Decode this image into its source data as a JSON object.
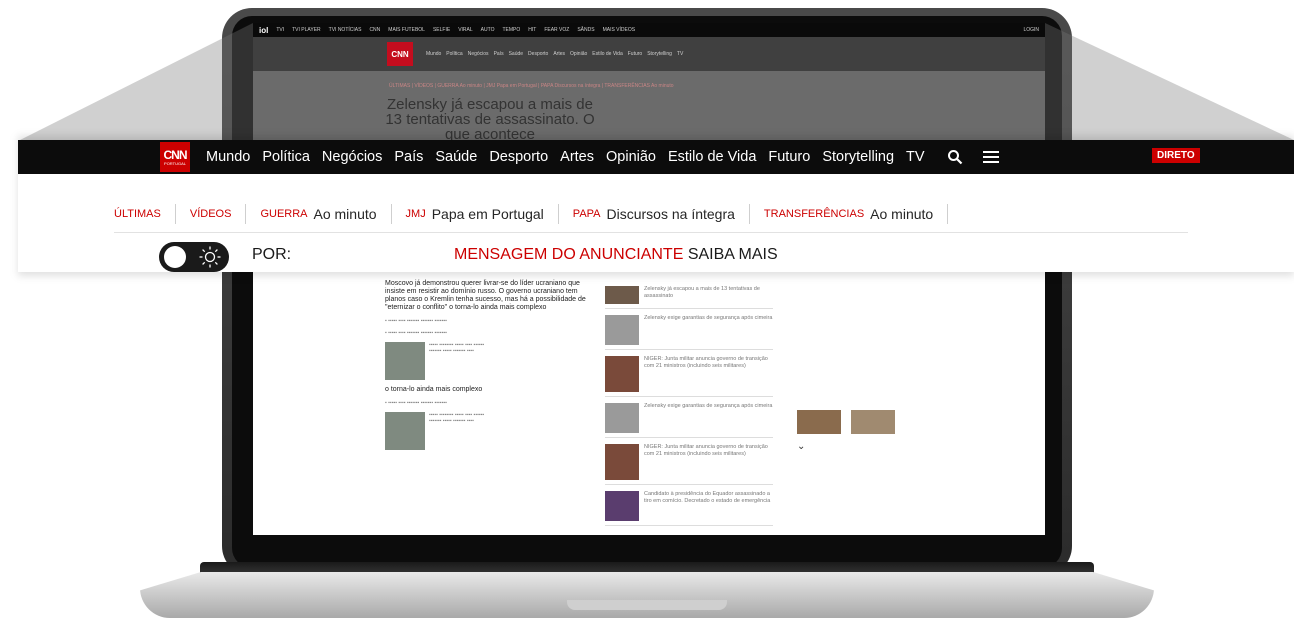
{
  "background_site": {
    "topbar": {
      "brand": "iol",
      "items": [
        "TVI",
        "TVI PLAYER",
        "TVI NOTÍCIAS",
        "CNN",
        "MAIS FUTEBOL",
        "SELFIE",
        "VIRAL",
        "AUTO",
        "TEMPO",
        "HIT",
        "FEAR VOZ",
        "SÂNDS",
        "MAIS VÍDEOS"
      ],
      "login": "LOGIN"
    },
    "nav_items": [
      "Mundo",
      "Política",
      "Negócios",
      "País",
      "Saúde",
      "Desporto",
      "Artes",
      "Opinião",
      "Estilo de Vida",
      "Futuro",
      "Storytelling",
      "TV"
    ],
    "tags_line": "ÚLTIMAS | VÍDEOS | GUERRA Ao minuto | JMJ Papa em Portugal | PAPA Discursos na íntegra | TRANSFERÊNCIAS Ao minuto",
    "headline": "Zelensky já escapou a mais de 13 tentativas de assassinato. O que acontece",
    "lead": "Moscovo já demonstrou querer livrar-se do líder ucraniano que insiste em resistir ao domínio russo. O governo ucraniano tem planos caso o Kremlin tenha sucesso, mas há a possibilidade de \"eternizar o conflito\" o torna-lo ainda mais complexo",
    "lead2": "o torna-lo ainda mais complexo",
    "side_items": [
      "Zelensky já escapou a mais de 13 tentativas de assassinato",
      "Zelensky exige garantias de segurança após cimeira",
      "NIGER: Junta militar anuncia governo de transição com 21 ministros (incluindo seis militares)",
      "Zelensky exige garantias de segurança após cimeira",
      "NIGER: Junta militar anuncia governo de transição com 21 ministros (incluindo seis militares)",
      "Candidato à presidência do Equador assassinado a tiro em comício. Decretado o estado de emergência"
    ]
  },
  "header": {
    "logo_main": "CNN",
    "logo_sub": "PORTUGAL",
    "nav": [
      "Mundo",
      "Política",
      "Negócios",
      "País",
      "Saúde",
      "Desporto",
      "Artes",
      "Opinião",
      "Estilo de Vida",
      "Futuro",
      "Storytelling",
      "TV"
    ],
    "live_label": "DIRETO"
  },
  "tags": [
    {
      "key": "ÚLTIMAS",
      "value": ""
    },
    {
      "key": "VÍDEOS",
      "value": ""
    },
    {
      "key": "GUERRA",
      "value": "Ao minuto"
    },
    {
      "key": "JMJ",
      "value": "Papa em Portugal"
    },
    {
      "key": "PAPA",
      "value": "Discursos na íntegra"
    },
    {
      "key": "TRANSFERÊNCIAS",
      "value": "Ao minuto"
    }
  ],
  "byline": {
    "label": "POR:",
    "ad_label": "MENSAGEM DO ANUNCIANTE",
    "ad_cta": "SAIBA MAIS"
  },
  "icons": {
    "search": "search-icon",
    "menu": "menu-icon",
    "theme": "sun-icon"
  },
  "colors": {
    "brand_red": "#cc0000",
    "nav_bg": "#0c0c0c"
  }
}
